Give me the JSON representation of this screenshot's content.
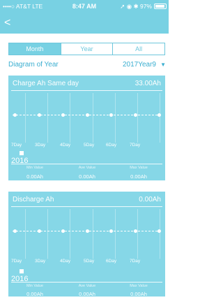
{
  "status_bar": {
    "carrier": "••••○ AT&T  LTE",
    "time": "8:47 AM",
    "right": "➚ ◉ ✱ 97%"
  },
  "nav": {
    "back_glyph": "<"
  },
  "segment": {
    "tabs": [
      {
        "label": "Month",
        "active": true
      },
      {
        "label": "Year",
        "active": false
      },
      {
        "label": "All",
        "active": false
      }
    ]
  },
  "diagram": {
    "label": "Diagram of Year",
    "value": "2017Year9",
    "arrow": "▼"
  },
  "colors": {
    "header": "#78d1e3",
    "card": "#86d7e7",
    "accent": "#3aaed0"
  },
  "charts": [
    {
      "title": "Charge Ah Same day",
      "total": "33.00Ah",
      "tick_labels": [
        "7Day",
        "3Day",
        "4Day",
        "5Day",
        "6Day",
        "7Day"
      ],
      "year": "2016",
      "stats": [
        {
          "label": "Min Value",
          "value": "0.00Ah"
        },
        {
          "label": "Ave Value",
          "value": "0.00Ah"
        },
        {
          "label": "Max Value",
          "value": "0.00Ah"
        }
      ]
    },
    {
      "title": "Discharge Ah",
      "total": "0.00Ah",
      "tick_labels": [
        "7Day",
        "3Day",
        "4Day",
        "5Day",
        "6Day",
        "7Day"
      ],
      "year": "2016",
      "stats": [
        {
          "label": "Min Value",
          "value": "0.00Ah"
        },
        {
          "label": "Ave Value",
          "value": "0.00Ah"
        },
        {
          "label": "Max Value",
          "value": "0.00Ah"
        }
      ]
    }
  ]
}
